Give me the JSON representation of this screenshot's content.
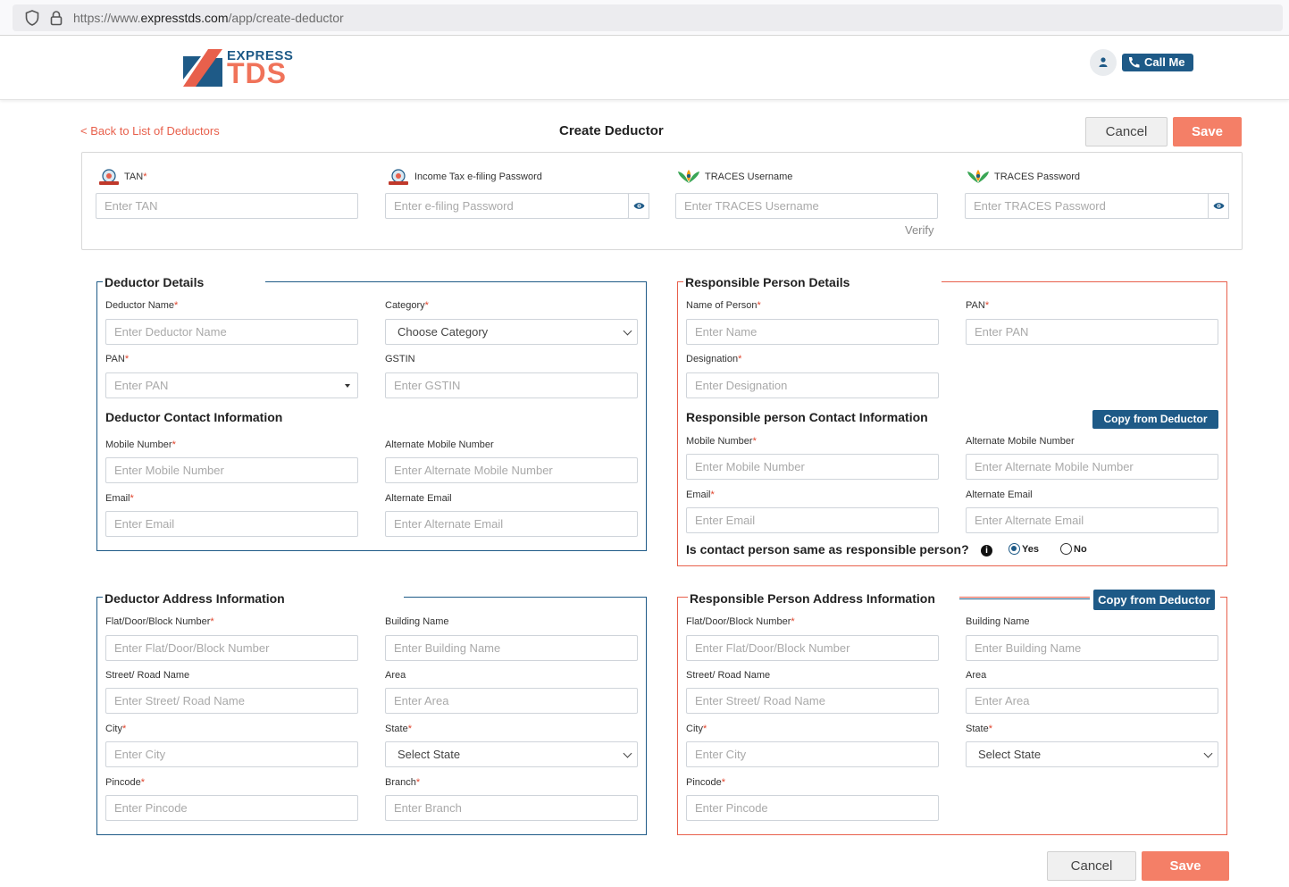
{
  "browser": {
    "url_prefix": "https://www.",
    "url_domain": "expresstds.com",
    "url_path": "/app/create-deductor"
  },
  "header": {
    "logo_top": "EXPRESS",
    "logo_bottom": "TDS",
    "call_me": "Call Me"
  },
  "page": {
    "back_link": "< Back to List of Deductors",
    "title": "Create Deductor",
    "cancel": "Cancel",
    "save": "Save"
  },
  "credentials": {
    "tan_label": "TAN",
    "tan_placeholder": "Enter TAN",
    "efiling_label": "Income Tax e-filing Password",
    "efiling_placeholder": "Enter e-filing Password",
    "traces_user_label": "TRACES Username",
    "traces_user_placeholder": "Enter TRACES Username",
    "traces_pass_label": "TRACES Password",
    "traces_pass_placeholder": "Enter TRACES Password",
    "verify": "Verify"
  },
  "deductor": {
    "title": "Deductor Details",
    "name_label": "Deductor Name",
    "name_placeholder": "Enter Deductor Name",
    "category_label": "Category",
    "category_value": "Choose Category",
    "pan_label": "PAN",
    "pan_placeholder": "Enter PAN",
    "gstin_label": "GSTIN",
    "gstin_placeholder": "Enter GSTIN",
    "contact_title": "Deductor Contact Information",
    "mobile_label": "Mobile Number",
    "mobile_placeholder": "Enter Mobile Number",
    "alt_mobile_label": "Alternate Mobile Number",
    "alt_mobile_placeholder": "Enter Alternate Mobile Number",
    "email_label": "Email",
    "email_placeholder": "Enter Email",
    "alt_email_label": "Alternate Email",
    "alt_email_placeholder": "Enter Alternate Email"
  },
  "responsible": {
    "title": "Responsible Person Details",
    "name_label": "Name of Person",
    "name_placeholder": "Enter Name",
    "pan_label": "PAN",
    "pan_placeholder": "Enter PAN",
    "designation_label": "Designation",
    "designation_placeholder": "Enter Designation",
    "contact_title": "Responsible person Contact Information",
    "copy_button": "Copy from Deductor",
    "mobile_label": "Mobile Number",
    "mobile_placeholder": "Enter Mobile Number",
    "alt_mobile_label": "Alternate Mobile Number",
    "alt_mobile_placeholder": "Enter Alternate Mobile Number",
    "email_label": "Email",
    "email_placeholder": "Enter Email",
    "alt_email_label": "Alternate Email",
    "alt_email_placeholder": "Enter Alternate Email",
    "same_question": "Is contact person same as responsible person?",
    "yes": "Yes",
    "no": "No"
  },
  "deductor_address": {
    "title": "Deductor Address Information",
    "flat_label": "Flat/Door/Block Number",
    "flat_placeholder": "Enter Flat/Door/Block Number",
    "building_label": "Building Name",
    "building_placeholder": "Enter Building Name",
    "street_label": "Street/ Road Name",
    "street_placeholder": "Enter Street/ Road Name",
    "area_label": "Area",
    "area_placeholder": "Enter Area",
    "city_label": "City",
    "city_placeholder": "Enter City",
    "state_label": "State",
    "state_value": "Select State",
    "pincode_label": "Pincode",
    "pincode_placeholder": "Enter Pincode",
    "branch_label": "Branch",
    "branch_placeholder": "Enter Branch"
  },
  "responsible_address": {
    "title": "Responsible Person Address Information",
    "copy_button": "Copy from Deductor",
    "flat_label": "Flat/Door/Block Number",
    "flat_placeholder": "Enter Flat/Door/Block Number",
    "building_label": "Building Name",
    "building_placeholder": "Enter Building Name",
    "street_label": "Street/ Road Name",
    "street_placeholder": "Enter Street/ Road Name",
    "area_label": "Area",
    "area_placeholder": "Enter Area",
    "city_label": "City",
    "city_placeholder": "Enter City",
    "state_label": "State",
    "state_value": "Select State",
    "pincode_label": "Pincode",
    "pincode_placeholder": "Enter Pincode"
  },
  "footer": {
    "cancel": "Cancel",
    "save": "Save"
  },
  "colors": {
    "brand_blue": "#1e5a87",
    "brand_coral": "#f47f67",
    "link_red": "#e8604c"
  }
}
